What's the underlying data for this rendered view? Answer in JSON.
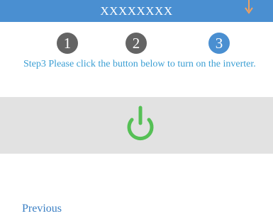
{
  "header": {
    "title": "XXXXXXXX",
    "color": "#4a8fd1",
    "arrow_icon": "down-arrow-icon",
    "arrow_color": "#f0a060"
  },
  "steps": {
    "items": [
      "1",
      "2",
      "3"
    ],
    "active": 3,
    "inactive_color": "#646464",
    "active_color": "#4a8fd1"
  },
  "instruction": {
    "text": "Step3 Please click the button below to turn on the inverter."
  },
  "power": {
    "icon": "power-icon",
    "icon_color": "#55c055",
    "panel_color": "#e2e2e2"
  },
  "footer": {
    "previous_label": "Previous"
  }
}
